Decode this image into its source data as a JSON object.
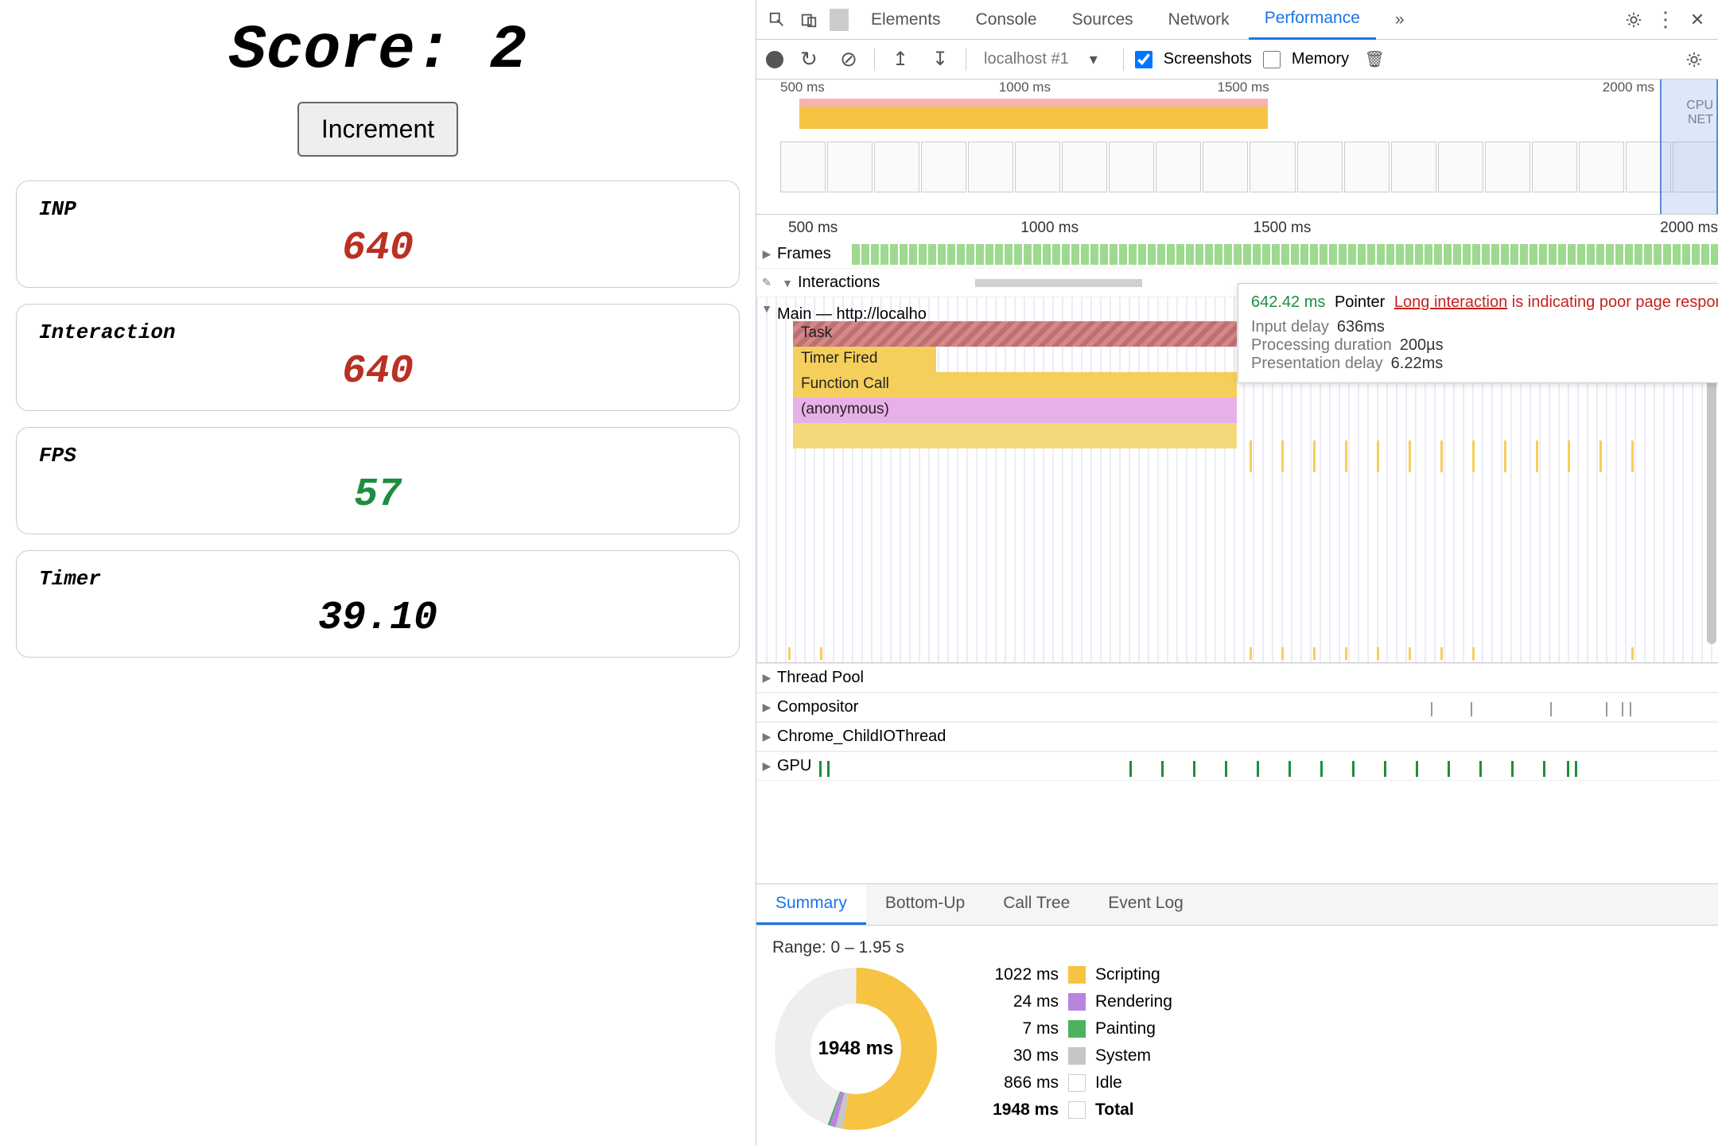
{
  "app": {
    "score_label": "Score:",
    "score_value": "2",
    "increment_label": "Increment",
    "metrics": {
      "inp": {
        "label": "INP",
        "value": "640",
        "color": "red"
      },
      "interaction": {
        "label": "Interaction",
        "value": "640",
        "color": "red"
      },
      "fps": {
        "label": "FPS",
        "value": "57",
        "color": "green"
      },
      "timer": {
        "label": "Timer",
        "value": "39.10",
        "color": "black"
      }
    }
  },
  "devtools": {
    "tabs": [
      "Elements",
      "Console",
      "Sources",
      "Network",
      "Performance"
    ],
    "active_tab": "Performance",
    "more_tabs": "»",
    "toolbar": {
      "target": "localhost #1",
      "screenshots_label": "Screenshots",
      "memory_label": "Memory"
    },
    "overview_ticks": [
      "500 ms",
      "1000 ms",
      "1500 ms",
      "2000 ms"
    ],
    "overview_side": {
      "cpu": "CPU",
      "net": "NET"
    },
    "flame_ticks": [
      "500 ms",
      "1000 ms",
      "1500 ms",
      "2000 ms"
    ],
    "tracks": {
      "frames": "Frames",
      "interactions": "Interactions",
      "main": "Main — http://localho",
      "thread_pool": "Thread Pool",
      "compositor": "Compositor",
      "child_io": "Chrome_ChildIOThread",
      "gpu": "GPU"
    },
    "flame_entries": {
      "task": "Task",
      "timer_fired": "Timer Fired",
      "function_call": "Function Call",
      "anonymous": "(anonymous)"
    },
    "tooltip": {
      "ms": "642.42 ms",
      "event": "Pointer",
      "link": "Long interaction",
      "warn_suffix": " is indicating poor page responsiveness.",
      "rows": [
        {
          "k": "Input delay",
          "v": "636ms"
        },
        {
          "k": "Processing duration",
          "v": "200µs"
        },
        {
          "k": "Presentation delay",
          "v": "6.22ms"
        }
      ]
    },
    "summary": {
      "tabs": [
        "Summary",
        "Bottom-Up",
        "Call Tree",
        "Event Log"
      ],
      "active": "Summary",
      "range": "Range: 0 – 1.95 s",
      "center": "1948 ms",
      "legend": [
        {
          "ms": "1022 ms",
          "swatch": "sw-scripting",
          "label": "Scripting"
        },
        {
          "ms": "24 ms",
          "swatch": "sw-rendering",
          "label": "Rendering"
        },
        {
          "ms": "7 ms",
          "swatch": "sw-painting",
          "label": "Painting"
        },
        {
          "ms": "30 ms",
          "swatch": "sw-system",
          "label": "System"
        },
        {
          "ms": "866 ms",
          "swatch": "sw-idle",
          "label": "Idle"
        },
        {
          "ms": "1948 ms",
          "swatch": "sw-total",
          "label": "Total"
        }
      ]
    }
  },
  "chart_data": {
    "type": "pie",
    "title": "Summary",
    "series": [
      {
        "name": "Scripting",
        "value": 1022,
        "color": "#f6c343"
      },
      {
        "name": "Rendering",
        "value": 24,
        "color": "#b983e0"
      },
      {
        "name": "Painting",
        "value": 7,
        "color": "#4cb25e"
      },
      {
        "name": "System",
        "value": 30,
        "color": "#c6c6c6"
      },
      {
        "name": "Idle",
        "value": 866,
        "color": "#eeeeee"
      }
    ],
    "total": 1948,
    "unit": "ms"
  }
}
